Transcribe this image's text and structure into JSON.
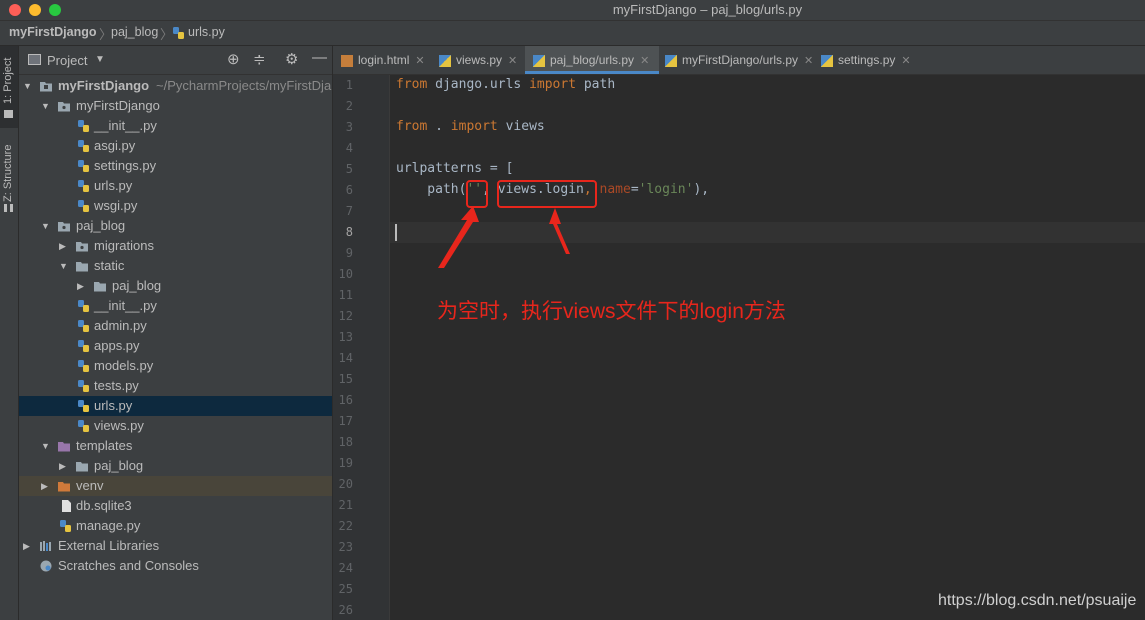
{
  "window": {
    "title": "myFirstDjango – paj_blog/urls.py"
  },
  "breadcrumbs": [
    "myFirstDjango",
    "paj_blog",
    "urls.py"
  ],
  "tool_strip": {
    "project_tab": "1: Project",
    "structure_tab": "Z: Structure"
  },
  "project_panel": {
    "title": "Project",
    "tree": [
      {
        "label": "myFirstDjango",
        "path": "~/PycharmProjects/myFirstDja",
        "icon": "folder-module-icon"
      },
      {
        "label": "myFirstDjango",
        "icon": "folder-package-icon"
      },
      {
        "label": "__init__.py",
        "icon": "python-file-icon"
      },
      {
        "label": "asgi.py",
        "icon": "python-file-icon"
      },
      {
        "label": "settings.py",
        "icon": "python-file-icon"
      },
      {
        "label": "urls.py",
        "icon": "python-file-icon"
      },
      {
        "label": "wsgi.py",
        "icon": "python-file-icon"
      },
      {
        "label": "paj_blog",
        "icon": "folder-package-icon"
      },
      {
        "label": "migrations",
        "icon": "folder-package-icon"
      },
      {
        "label": "static",
        "icon": "folder-icon"
      },
      {
        "label": "paj_blog",
        "icon": "folder-icon"
      },
      {
        "label": "__init__.py",
        "icon": "python-file-icon"
      },
      {
        "label": "admin.py",
        "icon": "python-file-icon"
      },
      {
        "label": "apps.py",
        "icon": "python-file-icon"
      },
      {
        "label": "models.py",
        "icon": "python-file-icon"
      },
      {
        "label": "tests.py",
        "icon": "python-file-icon"
      },
      {
        "label": "urls.py",
        "icon": "python-file-icon"
      },
      {
        "label": "views.py",
        "icon": "python-file-icon"
      },
      {
        "label": "templates",
        "icon": "folder-templates-icon"
      },
      {
        "label": "paj_blog",
        "icon": "folder-icon"
      },
      {
        "label": "venv",
        "icon": "folder-excluded-icon"
      },
      {
        "label": "db.sqlite3",
        "icon": "file-icon"
      },
      {
        "label": "manage.py",
        "icon": "python-file-icon"
      },
      {
        "label": "External Libraries",
        "icon": "libraries-icon"
      },
      {
        "label": "Scratches and Consoles",
        "icon": "scratches-icon"
      }
    ]
  },
  "editor_tabs": [
    {
      "label": "login.html",
      "icon": "html-file-icon",
      "active": false
    },
    {
      "label": "views.py",
      "icon": "python-file-icon",
      "active": false
    },
    {
      "label": "paj_blog/urls.py",
      "icon": "python-file-icon",
      "active": true
    },
    {
      "label": "myFirstDjango/urls.py",
      "icon": "python-file-icon",
      "active": false
    },
    {
      "label": "settings.py",
      "icon": "python-file-icon",
      "active": false
    }
  ],
  "line_numbers": [
    "1",
    "2",
    "3",
    "4",
    "5",
    "6",
    "7",
    "8",
    "9",
    "10",
    "11",
    "12",
    "13",
    "14",
    "15",
    "16",
    "17",
    "18",
    "19",
    "20",
    "21",
    "22",
    "23",
    "24",
    "25",
    "26"
  ],
  "code": {
    "line1": {
      "kw1": "from",
      "mod": " django.urls ",
      "kw2": "import",
      "name": " path"
    },
    "line3": {
      "kw1": "from",
      "mod": " . ",
      "kw2": "import",
      "name": " views"
    },
    "line5": "urlpatterns = [",
    "line6": {
      "indent": "    path(",
      "s1": "''",
      "c1": ", ",
      "ref": "views.login",
      "c2": ", ",
      "param": "name",
      "eq": "=",
      "s2": "'login'",
      "end": "),"
    }
  },
  "annotation": "为空时，执行views文件下的login方法",
  "watermark": "https://blog.csdn.net/psuaije",
  "colors": {
    "annotation_red": "#e8261c",
    "selection": "#0d293e",
    "tab_underline": "#4a88c7"
  }
}
